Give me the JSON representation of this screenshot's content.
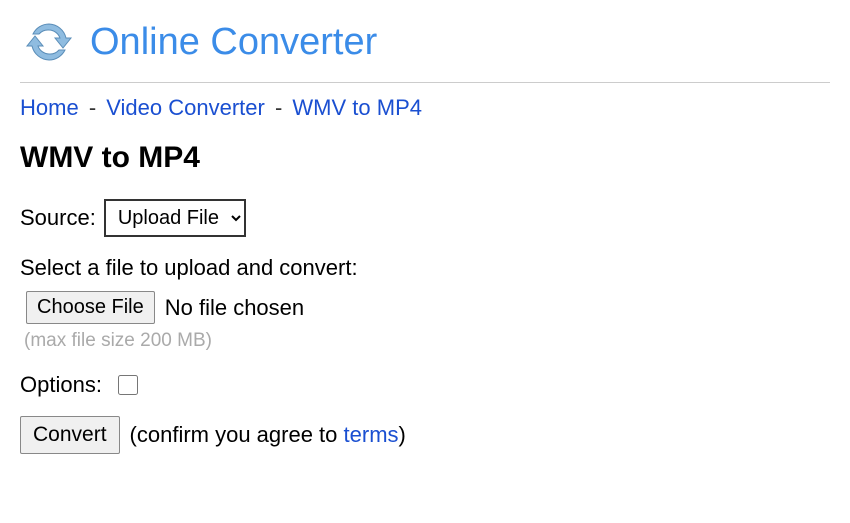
{
  "header": {
    "site_title": "Online Converter"
  },
  "breadcrumb": {
    "home": "Home",
    "video_converter": "Video Converter",
    "current": "WMV to MP4",
    "sep": "-"
  },
  "page": {
    "title": "WMV to MP4"
  },
  "form": {
    "source_label": "Source:",
    "source_selected": "Upload File",
    "file_prompt": "Select a file to upload and convert:",
    "choose_file_button": "Choose File",
    "file_status": "No file chosen",
    "max_size_hint": "(max file size 200 MB)",
    "options_label": "Options:",
    "convert_button": "Convert",
    "confirm_prefix": "(confirm you agree to ",
    "terms_link": "terms",
    "confirm_suffix": ")"
  }
}
